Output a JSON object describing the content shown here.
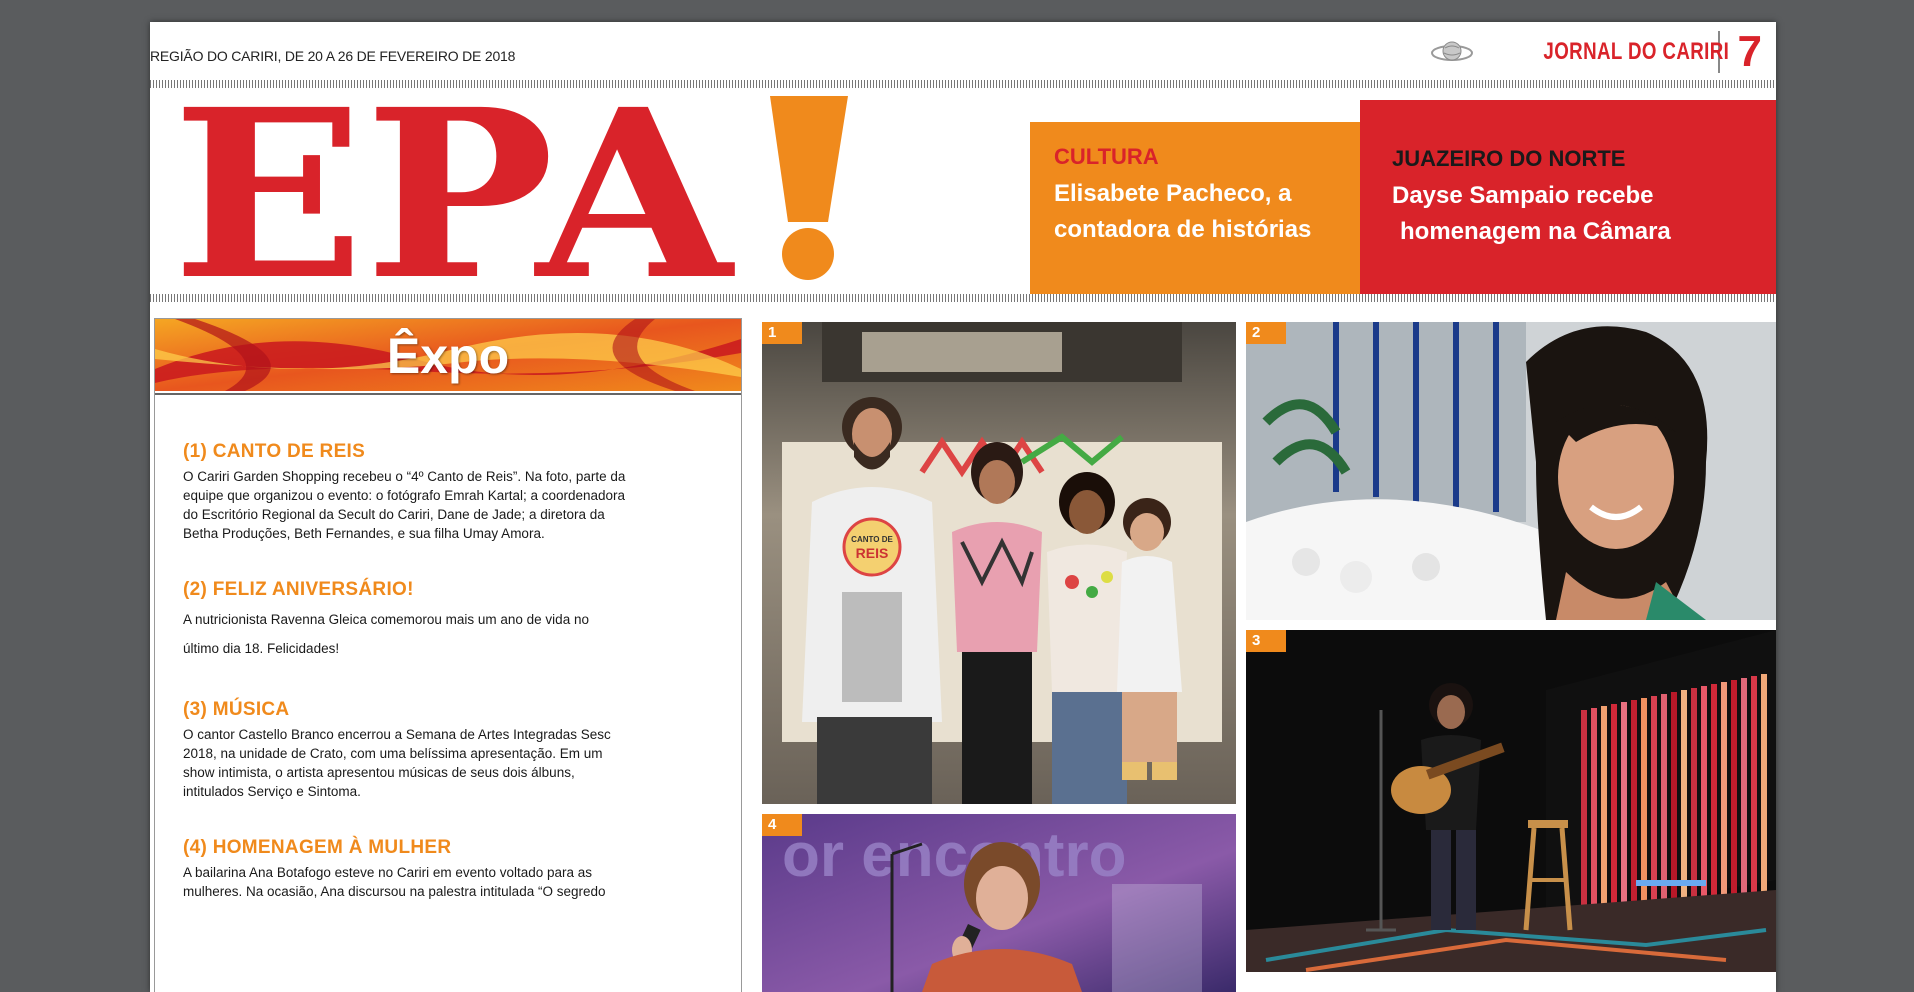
{
  "header": {
    "dateline": "REGIÃO DO CARIRI, DE 20 A 26 DE FEVEREIRO DE 2018",
    "paper_name": "JORNAL DO CARIRI",
    "page_number": "7",
    "section_logo": "EPA!"
  },
  "teasers": [
    {
      "kicker": "CULTURA",
      "headline_line1": "Elisabete Pacheco, a",
      "headline_line2": "contadora de histórias"
    },
    {
      "kicker": "JUAZEIRO DO NORTE",
      "headline_line1": "Dayse Sampaio recebe",
      "headline_line2": "homenagem na Câmara"
    }
  ],
  "expo": {
    "title": "Êxpo",
    "items": [
      {
        "heading": "(1) CANTO DE REIS",
        "lines": [
          "O Cariri Garden Shopping recebeu o “4º Canto de Reis”. Na foto, parte da",
          "equipe que organizou o evento: o fotógrafo Emrah Kartal; a coordenadora",
          "do Escritório Regional da Secult do Cariri, Dane de Jade; a diretora da",
          "Betha Produções, Beth Fernandes, e sua filha Umay Amora."
        ]
      },
      {
        "heading": "(2) FELIZ ANIVERSÁRIO!",
        "lines": [
          "A nutricionista Ravenna Gleica comemorou mais um ano de vida no",
          "último dia 18. Felicidades!"
        ]
      },
      {
        "heading": "(3) MÚSICA",
        "lines": [
          "O cantor Castello Branco encerrou a Semana de Artes Integradas Sesc",
          "2018, na unidade de Crato, com uma belíssima apresentação. Em um",
          "show intimista, o artista apresentou músicas de seus dois álbuns,",
          "intitulados Serviço e Sintoma."
        ]
      },
      {
        "heading": "(4) HOMENAGEM À MULHER",
        "lines": [
          "A bailarina Ana Botafogo esteve no Cariri em evento voltado para as",
          "mulheres. Na ocasião, Ana discursou na palestra intitulada “O segredo"
        ]
      }
    ]
  },
  "photos": [
    {
      "number": "1",
      "shirt_text_1": "CANTO DE",
      "shirt_text_2": "REIS"
    },
    {
      "number": "2"
    },
    {
      "number": "3"
    },
    {
      "number": "4",
      "backdrop_text": "or encontro"
    }
  ],
  "colors": {
    "red": "#d9232a",
    "orange": "#f08a1c",
    "viewer_bg": "#5a5c5e"
  }
}
